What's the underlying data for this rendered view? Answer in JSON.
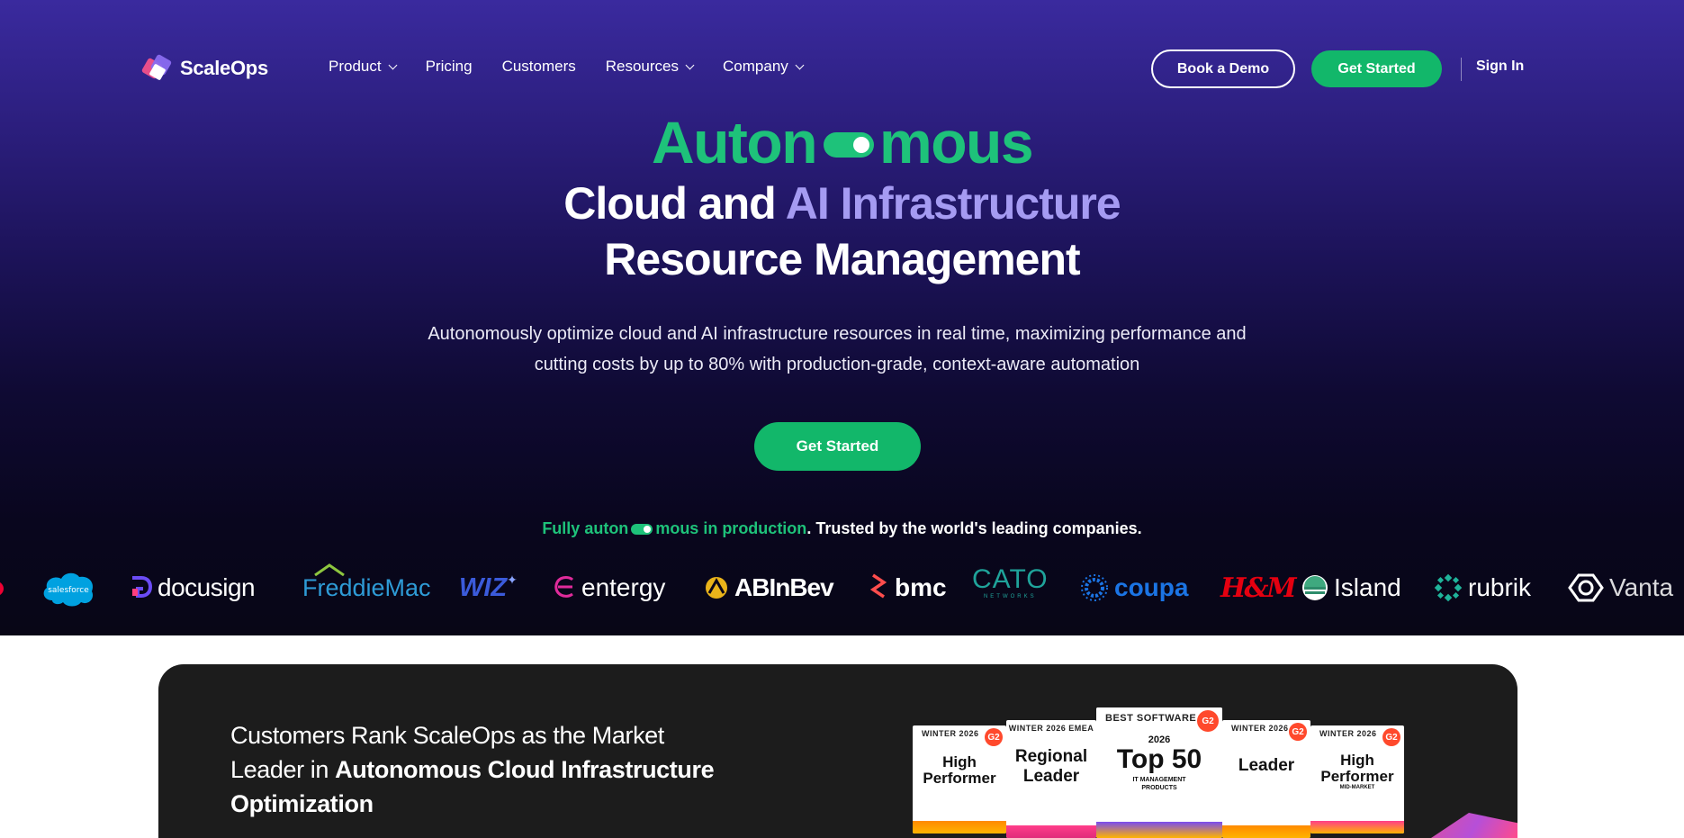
{
  "brand": {
    "name": "ScaleOps"
  },
  "nav": {
    "items": [
      {
        "label": "Product",
        "has_dropdown": true
      },
      {
        "label": "Pricing",
        "has_dropdown": false
      },
      {
        "label": "Customers",
        "has_dropdown": false
      },
      {
        "label": "Resources",
        "has_dropdown": true
      },
      {
        "label": "Company",
        "has_dropdown": true
      }
    ],
    "book_demo": "Book a Demo",
    "get_started": "Get Started",
    "sign_in": "Sign In"
  },
  "hero": {
    "word_part1": "Auton",
    "word_part2": "mous",
    "line2_a": "Cloud and ",
    "line2_b": "AI Infrastructure",
    "line3": "Resource Management",
    "subtitle_1": "Autonomously optimize cloud and AI infrastructure resources in real time, maximizing performance and",
    "subtitle_2": "cutting costs by up to 80% with production-grade, context-aware automation",
    "cta": "Get Started",
    "trust_green_a": "Fully auton",
    "trust_green_b": "mous in production",
    "trust_white": ". Trusted by the world's leading companies."
  },
  "logos": [
    {
      "name": "salesforce",
      "label": "salesforce",
      "color": "#00a1e0"
    },
    {
      "name": "docusign",
      "label": "docusign",
      "color": "#ffffff"
    },
    {
      "name": "freddie-mac",
      "label": "FreddieMac",
      "color": "#2e9bd6"
    },
    {
      "name": "wiz",
      "label": "WIZ",
      "color": "#3b5bdb"
    },
    {
      "name": "entergy",
      "label": "entergy",
      "color": "#ffffff"
    },
    {
      "name": "abinbev",
      "label": "ABInBev",
      "color": "#ffffff"
    },
    {
      "name": "bmc",
      "label": "bmc",
      "color": "#ffffff"
    },
    {
      "name": "cato",
      "label": "CATO",
      "color": "#1fa39a"
    },
    {
      "name": "coupa",
      "label": "coupa",
      "color": "#1b74e4"
    },
    {
      "name": "hm",
      "label": "H&M",
      "color": "#e50010"
    },
    {
      "name": "island",
      "label": "Island",
      "color": "#ffffff"
    },
    {
      "name": "rubrik",
      "label": "rubrik",
      "color": "#ffffff"
    },
    {
      "name": "vanta",
      "label": "Vanta",
      "color": "#ffffff"
    }
  ],
  "cato_sub": "NETWORKS",
  "card": {
    "text_1": "Customers Rank ScaleOps as the Market",
    "text_2a": "Leader in ",
    "text_2b": "Autonomous Cloud Infrastructure",
    "text_3": "Optimization"
  },
  "badges": [
    {
      "top": "WINTER 2026",
      "main": "High Performer",
      "sub": ""
    },
    {
      "top": "WINTER 2026 EMEA",
      "main": "Regional Leader",
      "sub": ""
    },
    {
      "top": "BEST SOFTWARE",
      "main": "Top 50",
      "year": "2026",
      "sub": "IT MANAGEMENT PRODUCTS"
    },
    {
      "top": "WINTER 2026",
      "main": "Leader",
      "sub": ""
    },
    {
      "top": "WINTER 2026",
      "main": "High Performer",
      "sub": "MID-MARKET"
    }
  ],
  "g2_label": "G2",
  "colors": {
    "accent_green": "#12b76a",
    "headline_green": "#1ec27a",
    "purple": "#a59bf2"
  }
}
